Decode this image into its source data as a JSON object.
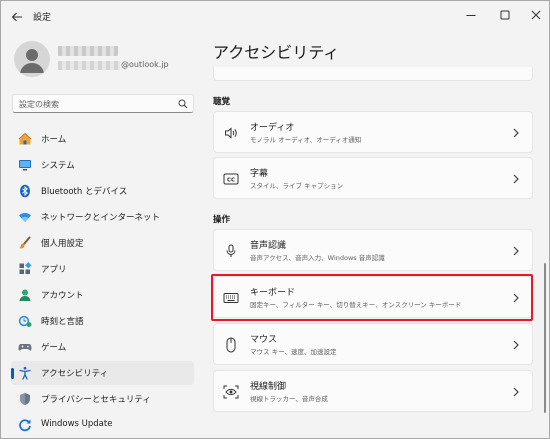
{
  "window": {
    "title": "設定"
  },
  "profile": {
    "email_domain": "@outlook.jp"
  },
  "search": {
    "placeholder": "設定の検索"
  },
  "sidebar": {
    "items": [
      {
        "label": "ホーム",
        "icon": "home-icon"
      },
      {
        "label": "システム",
        "icon": "system-icon"
      },
      {
        "label": "Bluetooth とデバイス",
        "icon": "bluetooth-icon"
      },
      {
        "label": "ネットワークとインターネット",
        "icon": "network-icon"
      },
      {
        "label": "個人用設定",
        "icon": "personalization-icon"
      },
      {
        "label": "アプリ",
        "icon": "apps-icon"
      },
      {
        "label": "アカウント",
        "icon": "account-icon"
      },
      {
        "label": "時刻と言語",
        "icon": "time-language-icon"
      },
      {
        "label": "ゲーム",
        "icon": "gaming-icon"
      },
      {
        "label": "アクセシビリティ",
        "icon": "accessibility-icon",
        "active": true
      },
      {
        "label": "プライバシーとセキュリティ",
        "icon": "privacy-shield-icon"
      },
      {
        "label": "Windows Update",
        "icon": "windows-update-icon"
      }
    ]
  },
  "main": {
    "title": "アクセシビリティ",
    "sections": [
      {
        "title": "聴覚",
        "cards": [
          {
            "title": "オーディオ",
            "subtitle": "モノラル オーディオ、オーディオ通知",
            "icon": "speaker-icon"
          },
          {
            "title": "字幕",
            "subtitle": "スタイル、ライブ キャプション",
            "icon": "captions-icon"
          }
        ]
      },
      {
        "title": "操作",
        "cards": [
          {
            "title": "音声認識",
            "subtitle": "音声アクセス、音声入力、Windows 音声認識",
            "icon": "microphone-icon"
          },
          {
            "title": "キーボード",
            "subtitle": "固定キー、フィルター キー、切り替えキー、オンスクリーン キーボード",
            "icon": "keyboard-icon",
            "highlighted": true
          },
          {
            "title": "マウス",
            "subtitle": "マウス キー、速度、加速設定",
            "icon": "mouse-icon"
          },
          {
            "title": "視線制御",
            "subtitle": "視線トラッカー、音声合成",
            "icon": "eye-control-icon"
          }
        ]
      }
    ]
  },
  "colors": {
    "accent": "#005fb8",
    "highlight": "#e8182b"
  }
}
